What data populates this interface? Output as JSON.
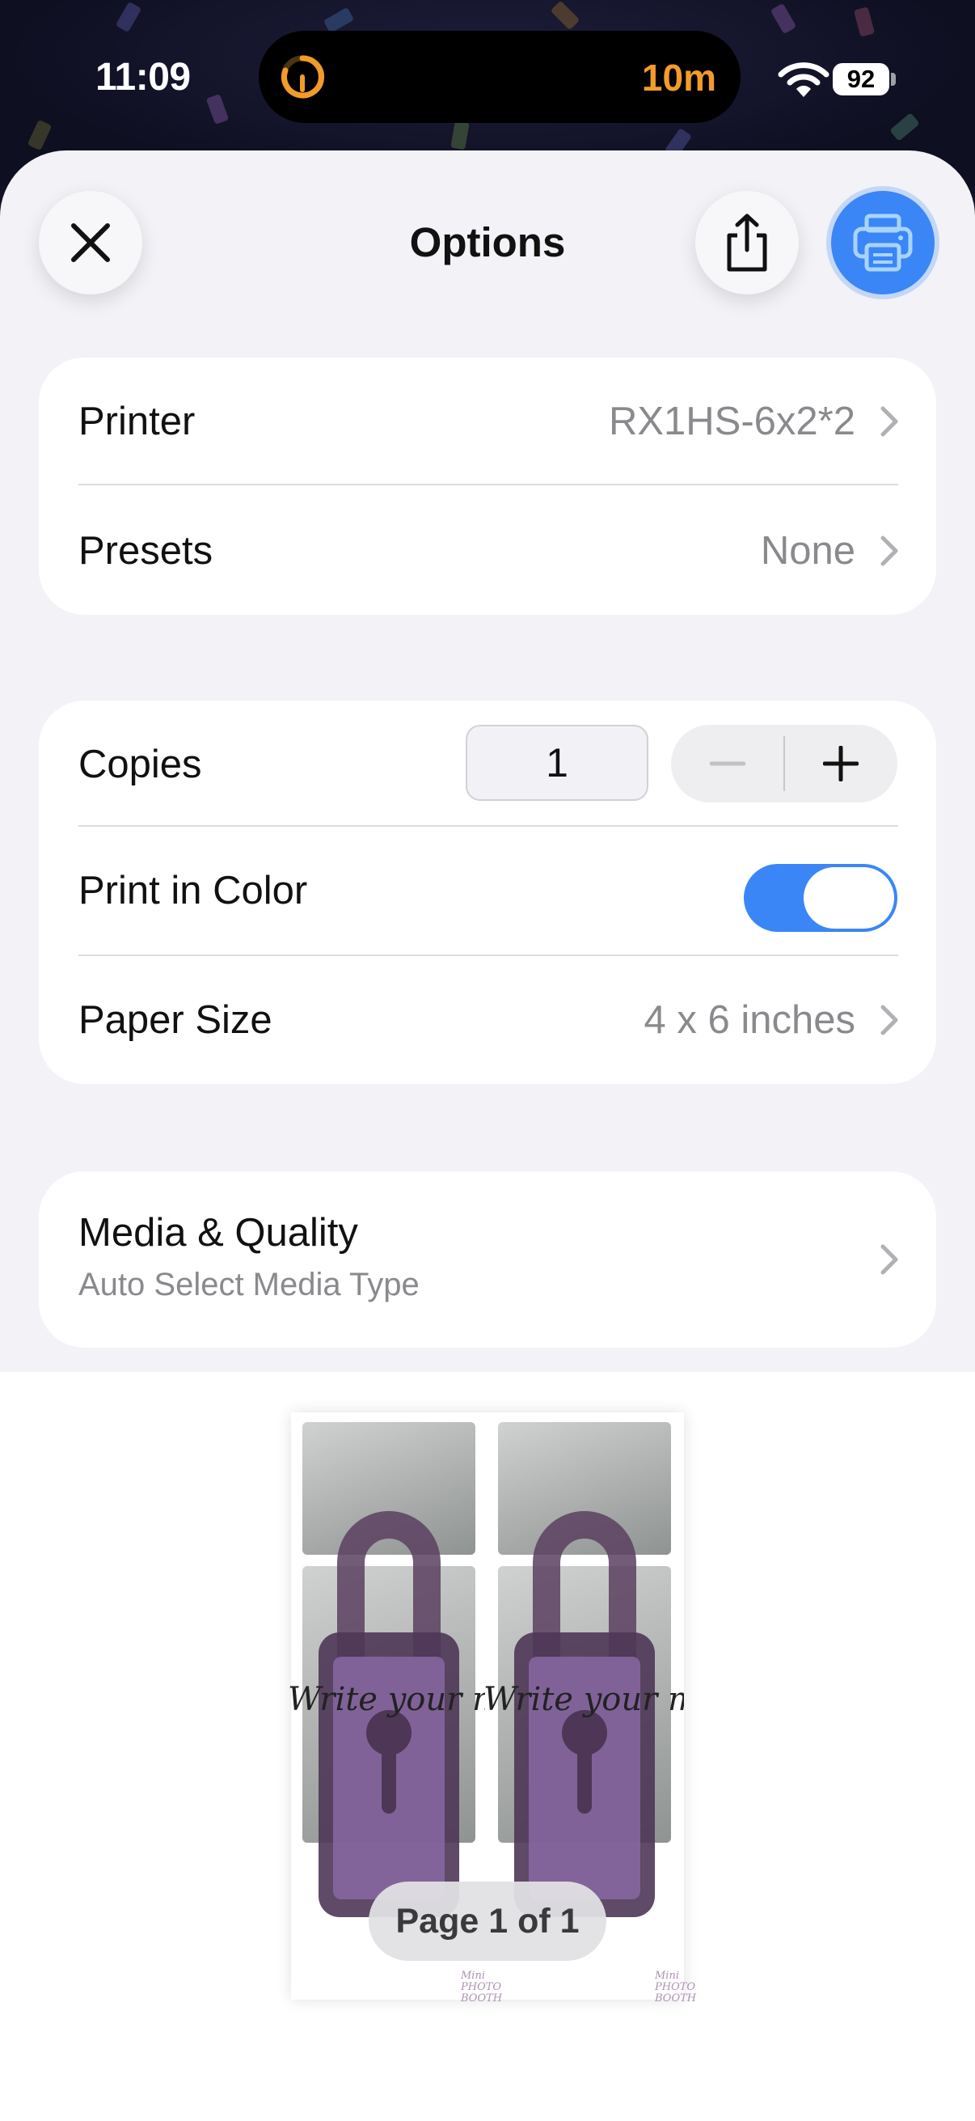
{
  "status_bar": {
    "time": "11:09",
    "activity_timer": "10m",
    "battery_level": "92"
  },
  "header": {
    "title": "Options",
    "close_icon": "close-icon",
    "share_icon": "share-icon",
    "print_icon": "printer-icon",
    "print_button_color": "#3a86f7"
  },
  "printer_card": {
    "printer_label": "Printer",
    "printer_value": "RX1HS-6x2*2",
    "presets_label": "Presets",
    "presets_value": "None"
  },
  "settings_card": {
    "copies_label": "Copies",
    "copies_value": "1",
    "print_color_label": "Print in Color",
    "print_color_on": true,
    "paper_size_label": "Paper Size",
    "paper_size_value": "4 x 6 inches"
  },
  "media_card": {
    "title": "Media & Quality",
    "subtitle": "Auto Select Media Type"
  },
  "preview": {
    "overlay_text_left": "Write your message",
    "overlay_text_right": "Write your message",
    "logo_text": "Mini PHOTO BOOTH",
    "page_indicator": "Page 1 of 1"
  }
}
